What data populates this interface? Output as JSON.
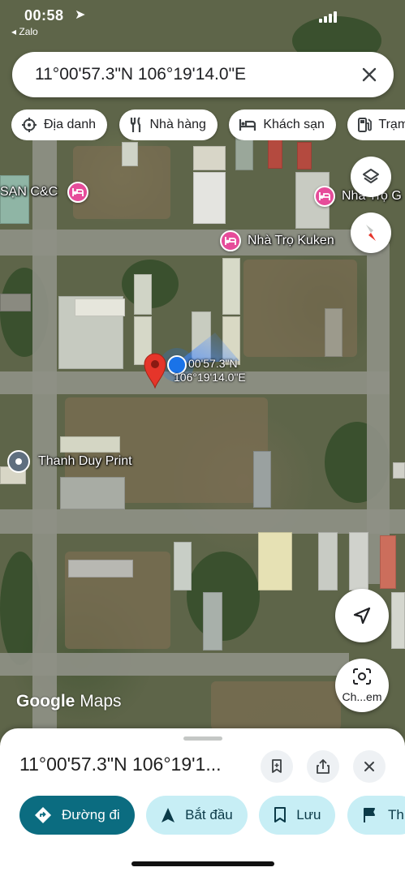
{
  "status_bar": {
    "time": "00:58",
    "back_app": "◂ Zalo"
  },
  "search": {
    "query": "11°00'57.3\"N 106°19'14.0\"E"
  },
  "chips": [
    {
      "icon": "landmark-icon",
      "label": "Địa danh"
    },
    {
      "icon": "restaurant-icon",
      "label": "Nhà hàng"
    },
    {
      "icon": "hotel-icon",
      "label": "Khách sạn"
    },
    {
      "icon": "gas-station-icon",
      "label": "Trạm"
    }
  ],
  "map": {
    "pois": {
      "hotel_cc": "SẠN C&C",
      "hotel_g": "Nhà Trọ G",
      "hotel_kuken": "Nhà Trọ Kuken",
      "print_shop": "Thanh Duy Print"
    },
    "pin_coords": {
      "lat": "00'57.3\"N",
      "lng": "106°19'14.0\"E"
    },
    "logo": {
      "google": "Google",
      "maps": "Maps"
    },
    "camera_label": "Ch...em"
  },
  "sheet": {
    "title": "11°00'57.3\"N 106°19'1...",
    "actions": [
      {
        "label": "Đường đi",
        "style": "primary"
      },
      {
        "label": "Bắt đầu",
        "style": "secondary"
      },
      {
        "label": "Lưu",
        "style": "secondary"
      },
      {
        "label": "Th",
        "style": "secondary"
      }
    ]
  },
  "colors": {
    "primary": "#0b6c80",
    "secondary": "#c7eef5",
    "hotel_pin": "#e64c9a",
    "location_dot": "#1a73e8",
    "red_pin": "#e5352a"
  }
}
